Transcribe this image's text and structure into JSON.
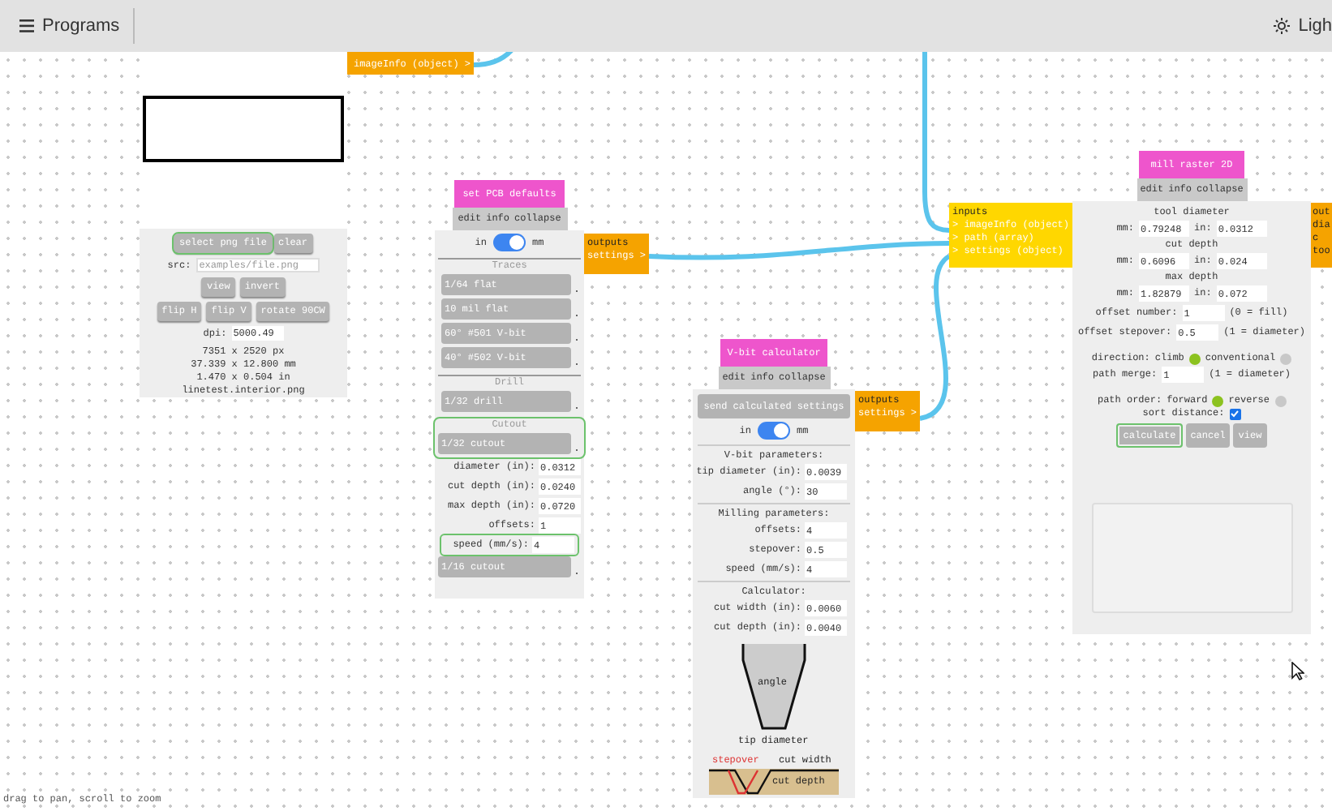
{
  "top_bar": {
    "menu_label": "Programs",
    "theme_label": "Ligh"
  },
  "image_module": {
    "outputs": [
      "imageInfo (object) >"
    ],
    "file_buttons": [
      {
        "label": "select png file",
        "highlighted": true
      },
      {
        "label": "clear",
        "highlighted": false
      }
    ],
    "src_label": "src:",
    "src_placeholder": "examples/file.png",
    "view_buttons": [
      "view",
      "invert"
    ],
    "transform_buttons": [
      "flip H",
      "flip V",
      "rotate 90CW"
    ],
    "dpi_label": "dpi:",
    "dpi_value": "5000.49",
    "info": [
      "7351 x 2520 px",
      "37.339 x 12.800 mm",
      "1.470 x 0.504 in",
      "linetest.interior.png"
    ]
  },
  "pcb_defaults": {
    "title": "set PCB defaults",
    "menu": [
      "edit",
      "info",
      "collapse"
    ],
    "units": {
      "left": "in",
      "right": "mm",
      "on": true
    },
    "sections": [
      {
        "heading": "Traces",
        "highlighted": false,
        "presets": [
          "1/64 flat",
          "10 mil flat",
          "60° #501 V-bit",
          "40° #502 V-bit"
        ]
      },
      {
        "heading": "Drill",
        "highlighted": false,
        "presets": [
          "1/32 drill"
        ]
      },
      {
        "heading": "Cutout",
        "highlighted": true,
        "presets": [
          "1/32 cutout"
        ]
      }
    ],
    "fields": [
      {
        "label": "diameter (in):",
        "value": "0.0312",
        "highlighted": false
      },
      {
        "label": "cut depth (in):",
        "value": "0.0240",
        "highlighted": false
      },
      {
        "label": "max depth (in):",
        "value": "0.0720",
        "highlighted": false
      },
      {
        "label": "offsets:",
        "value": "1",
        "highlighted": false
      },
      {
        "label": "speed (mm/s):",
        "value": "4",
        "highlighted": true
      }
    ],
    "more_presets": [
      "1/16 cutout"
    ],
    "outputs": {
      "heading": "outputs",
      "ports": [
        "settings >"
      ]
    }
  },
  "vbit_calculator": {
    "title": "V-bit calculator",
    "menu": [
      "edit",
      "info",
      "collapse"
    ],
    "send_button": "send calculated settings",
    "units": {
      "left": "in",
      "right": "mm",
      "on": true
    },
    "groups": [
      {
        "heading": "V-bit parameters:",
        "fields": [
          {
            "label": "tip diameter (in):",
            "value": "0.0039"
          },
          {
            "label": "angle (°):",
            "value": "30"
          }
        ]
      },
      {
        "heading": "Milling parameters:",
        "fields": [
          {
            "label": "offsets:",
            "value": "4"
          },
          {
            "label": "stepover:",
            "value": "0.5"
          },
          {
            "label": "speed (mm/s):",
            "value": "4"
          }
        ]
      },
      {
        "heading": "Calculator:",
        "fields": [
          {
            "label": "cut width (in):",
            "value": "0.0060"
          },
          {
            "label": "cut depth (in):",
            "value": "0.0040"
          }
        ]
      }
    ],
    "diagram": {
      "angle": "angle",
      "tip": "tip diameter",
      "stepover": "stepover",
      "width": "cut width",
      "depth": "cut depth"
    },
    "outputs": {
      "heading": "outputs",
      "ports": [
        "settings >"
      ]
    }
  },
  "mill_raster": {
    "title": "mill raster 2D",
    "menu": [
      "edit",
      "info",
      "collapse"
    ],
    "inputs": {
      "heading": "inputs",
      "ports": [
        "> imageInfo (object)",
        "> path (array)",
        "> settings (object)"
      ]
    },
    "dims": [
      {
        "heading": "tool diameter",
        "mm_label": "mm:",
        "mm": "0.79248",
        "in_label": "in:",
        "in": "0.0312"
      },
      {
        "heading": "cut depth",
        "mm_label": "mm:",
        "mm": "0.6096",
        "in_label": "in:",
        "in": "0.024"
      },
      {
        "heading": "max depth",
        "mm_label": "mm:",
        "mm": "1.82879",
        "in_label": "in:",
        "in": "0.072"
      }
    ],
    "rows": [
      {
        "label": "offset number:",
        "value": "1",
        "hint": "(0 = fill)"
      },
      {
        "label": "offset stepover:",
        "value": "0.5",
        "hint": "(1 = diameter)"
      }
    ],
    "direction": {
      "label": "direction:",
      "options": [
        {
          "label": "climb",
          "selected": true
        },
        {
          "label": "conventional",
          "selected": false
        }
      ]
    },
    "path_merge": {
      "label": "path merge:",
      "value": "1",
      "hint": "(1 = diameter)"
    },
    "path_order": {
      "label": "path order:",
      "options": [
        {
          "label": "forward",
          "selected": true
        },
        {
          "label": "reverse",
          "selected": false
        }
      ]
    },
    "sort_distance": {
      "label": "sort distance:",
      "checked": true
    },
    "buttons": [
      {
        "label": "calculate",
        "highlighted": true
      },
      {
        "label": "cancel",
        "highlighted": false
      },
      {
        "label": "view",
        "highlighted": false
      }
    ],
    "outputs_partial": [
      "out",
      "dia",
      "c",
      "too"
    ]
  },
  "hint": "drag to pan, scroll to zoom"
}
